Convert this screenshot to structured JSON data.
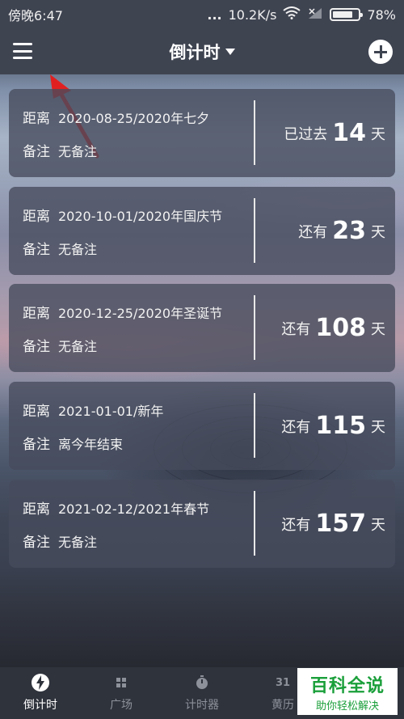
{
  "status_bar": {
    "time": "傍晚6:47",
    "dots": "...",
    "network_speed": "10.2K/s",
    "wifi_icon": "wifi-icon",
    "signal_icon": "signal-icon",
    "battery_percent": "78%",
    "battery_level": 0.78
  },
  "header": {
    "menu_icon": "menu-icon",
    "title": "倒计时",
    "dropdown_icon": "caret-down-icon",
    "add_icon": "plus-circle-icon"
  },
  "cards": [
    {
      "distance_label": "距离",
      "event": "2020-08-25/2020年七夕",
      "note_label": "备注",
      "note": "无备注",
      "prefix": "已过去",
      "days": "14",
      "unit": "天"
    },
    {
      "distance_label": "距离",
      "event": "2020-10-01/2020年国庆节",
      "note_label": "备注",
      "note": "无备注",
      "prefix": "还有",
      "days": "23",
      "unit": "天"
    },
    {
      "distance_label": "距离",
      "event": "2020-12-25/2020年圣诞节",
      "note_label": "备注",
      "note": "无备注",
      "prefix": "还有",
      "days": "108",
      "unit": "天"
    },
    {
      "distance_label": "距离",
      "event": "2021-01-01/新年",
      "note_label": "备注",
      "note": "离今年结束",
      "prefix": "还有",
      "days": "115",
      "unit": "天"
    },
    {
      "distance_label": "距离",
      "event": "2021-02-12/2021年春节",
      "note_label": "备注",
      "note": "无备注",
      "prefix": "还有",
      "days": "157",
      "unit": "天"
    }
  ],
  "bottom_nav": [
    {
      "label": "倒计时",
      "icon": "lightning-icon",
      "active": true
    },
    {
      "label": "广场",
      "icon": "grid-icon",
      "active": false
    },
    {
      "label": "计时器",
      "icon": "stopwatch-icon",
      "active": false
    },
    {
      "label": "黄历",
      "icon": "calendar-31-icon",
      "icon_text": "31",
      "active": false
    }
  ],
  "watermark": {
    "title": "百科全说",
    "subtitle": "助你轻松解决"
  }
}
